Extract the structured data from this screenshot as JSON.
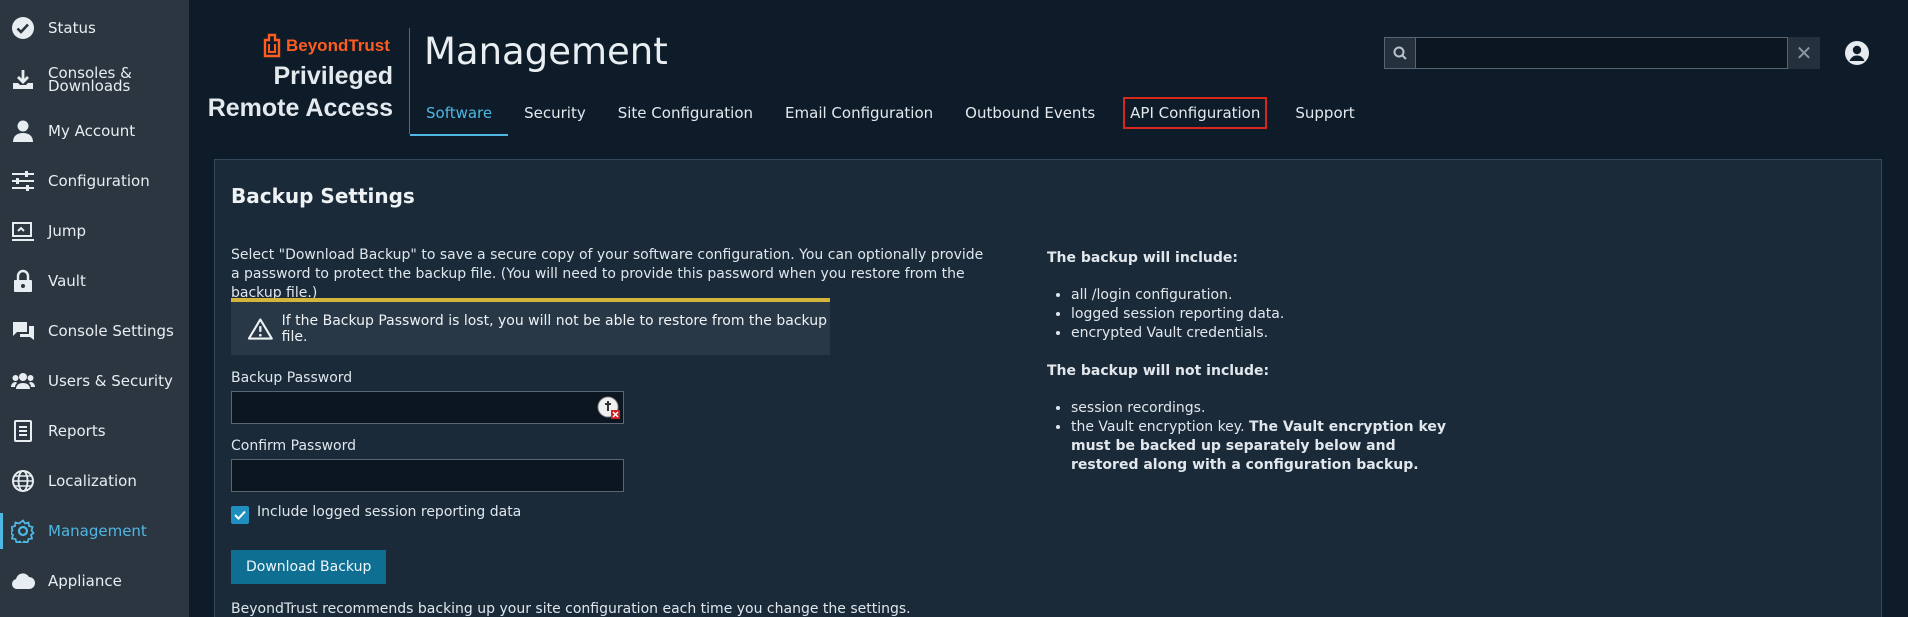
{
  "sidebar": {
    "items": [
      {
        "label": "Status",
        "icon": "check-circle-icon"
      },
      {
        "label": "Consoles &",
        "label2": "Downloads",
        "icon": "download-icon"
      },
      {
        "label": "My Account",
        "icon": "person-icon"
      },
      {
        "label": "Configuration",
        "icon": "sliders-icon"
      },
      {
        "label": "Jump",
        "icon": "jump-icon"
      },
      {
        "label": "Vault",
        "icon": "lock-icon"
      },
      {
        "label": "Console Settings",
        "icon": "chat-icon"
      },
      {
        "label": "Users & Security",
        "icon": "users-icon"
      },
      {
        "label": "Reports",
        "icon": "report-icon"
      },
      {
        "label": "Localization",
        "icon": "globe-icon"
      },
      {
        "label": "Management",
        "icon": "gear-icon"
      },
      {
        "label": "Appliance",
        "icon": "cloud-icon"
      }
    ],
    "active_index": 10
  },
  "brand": {
    "logo_text": "BeyondTrust",
    "line1": "Privileged",
    "line2": "Remote Access",
    "logo_color": "#ff5c1f"
  },
  "header": {
    "title": "Management",
    "tabs": [
      {
        "label": "Software"
      },
      {
        "label": "Security"
      },
      {
        "label": "Site Configuration"
      },
      {
        "label": "Email Configuration"
      },
      {
        "label": "Outbound Events"
      },
      {
        "label": "API Configuration"
      },
      {
        "label": "Support"
      }
    ],
    "active_tab": "Software",
    "highlighted_tab": "API Configuration",
    "search_value": "",
    "clear_glyph": "✕"
  },
  "backup": {
    "title": "Backup Settings",
    "description": "Select \"Download Backup\" to save a secure copy of your software configuration. You can optionally provide a password to protect the backup file. (You will need to provide this password when you restore from the backup file.)",
    "warning": "If the Backup Password is lost, you will not be able to restore from the backup file.",
    "password_label": "Backup Password",
    "password_value": "",
    "confirm_label": "Confirm Password",
    "confirm_value": "",
    "include_checkbox_label": "Include logged session reporting data",
    "include_checked": true,
    "download_button": "Download Backup",
    "footer_note": "BeyondTrust recommends backing up your site configuration each time you change the settings.",
    "include_heading": "The backup will include:",
    "include_items": [
      "all /login configuration.",
      "logged session reporting data.",
      "encrypted Vault credentials."
    ],
    "exclude_heading": "The backup will not include:",
    "exclude_items": [
      "session recordings."
    ],
    "exclude_vault_prefix": "the Vault encryption key.",
    "exclude_vault_bold": "The Vault encryption key must be backed up separately below and restored along with a configuration backup."
  },
  "colors": {
    "accent": "#4fb7e3",
    "warning_bar": "#d2b53a",
    "highlight_border": "#d9261c",
    "button": "#0f6f93"
  }
}
